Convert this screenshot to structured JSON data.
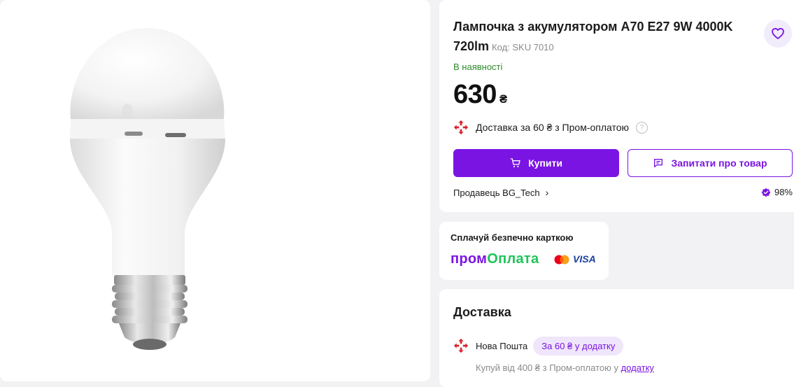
{
  "product": {
    "title": "Лампочка з акумулятором A70 E27 9W 4000K 720lm",
    "sku": "Код: SKU 7010",
    "stock": "В наявності",
    "price": "630",
    "currency": "₴"
  },
  "delivery_promo": {
    "text": "Доставка за 60 ₴ з Пром-оплатою",
    "help_icon": "?"
  },
  "actions": {
    "buy_label": "Купити",
    "ask_label": "Запитати про товар"
  },
  "seller": {
    "label": "Продавець BG_Tech",
    "rating": "98%"
  },
  "payment": {
    "title": "Сплачуй безпечно карткою",
    "logo_part1": "пром",
    "logo_part2": "Оплата",
    "visa": "VISA"
  },
  "delivery": {
    "title": "Доставка",
    "carrier": "Нова Пошта",
    "badge": "За 60 ₴ у додатку",
    "note_prefix": "Купуй від 400 ₴ з Пром-оплатою у ",
    "note_link": "додатку"
  },
  "colors": {
    "accent": "#7a14e3",
    "stock_green": "#2e8b2e",
    "promoplata_green": "#1fc45a",
    "novaposhta_red": "#d9232e"
  },
  "icons": [
    "heart-icon",
    "cart-icon",
    "chat-icon",
    "nova-poshta-icon",
    "help-icon",
    "chevron-right-icon",
    "rating-badge-icon",
    "mastercard-icon"
  ]
}
